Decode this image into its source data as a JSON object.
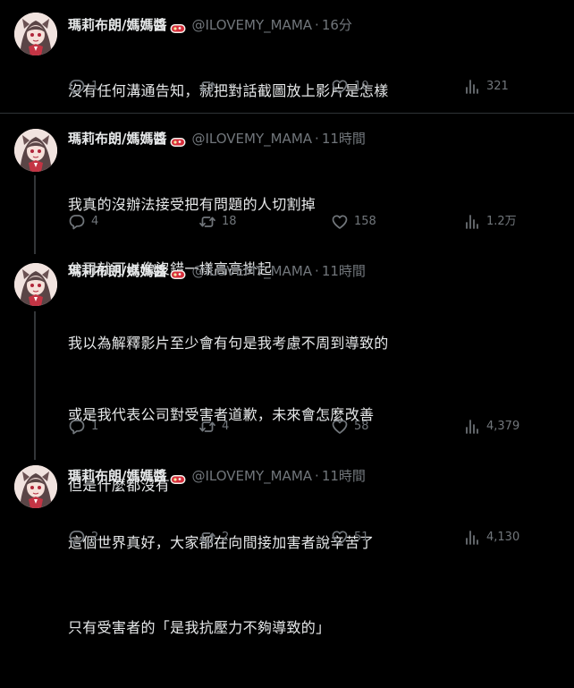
{
  "colors": {
    "background": "#000000",
    "text": "#e7e9ea",
    "muted": "#71767b",
    "divider": "#2f3336"
  },
  "tweets": [
    {
      "display_name": "瑪莉布朗/媽媽醬",
      "handle": "@ILOVEMY_MAMA",
      "time": "16分",
      "lines": [
        "沒有任何溝通告知，就把對話截圖放上影片是怎樣"
      ],
      "replies": "1",
      "retweets": "",
      "likes": "10",
      "views": "321",
      "badge_icon": "bento-icon"
    },
    {
      "display_name": "瑪莉布朗/媽媽醬",
      "handle": "@ILOVEMY_MAMA",
      "time": "11時間",
      "lines": [
        "我真的沒辦法接受把有問題的人切割掉",
        "公司就可以像沒錯一樣高高掛起"
      ],
      "replies": "4",
      "retweets": "18",
      "likes": "158",
      "views": "1.2万",
      "badge_icon": "bento-icon"
    },
    {
      "display_name": "瑪莉布朗/媽媽醬",
      "handle": "@ILOVEMY_MAMA",
      "time": "11時間",
      "lines": [
        "我以為解釋影片至少會有句是我考慮不周到導致的",
        "或是我代表公司對受害者道歉，未來會怎麼改善",
        "但是什麼都沒有",
        "",
        "只有受害者的「是我抗壓力不夠導致的」"
      ],
      "replies": "1",
      "retweets": "4",
      "likes": "58",
      "views": "4,379",
      "badge_icon": "bento-icon"
    },
    {
      "display_name": "瑪莉布朗/媽媽醬",
      "handle": "@ILOVEMY_MAMA",
      "time": "11時間",
      "lines": [
        "這個世界真好，大家都在向間接加害者說辛苦了"
      ],
      "replies": "2",
      "retweets": "2",
      "likes": "51",
      "views": "4,130",
      "badge_icon": "bento-icon"
    }
  ]
}
